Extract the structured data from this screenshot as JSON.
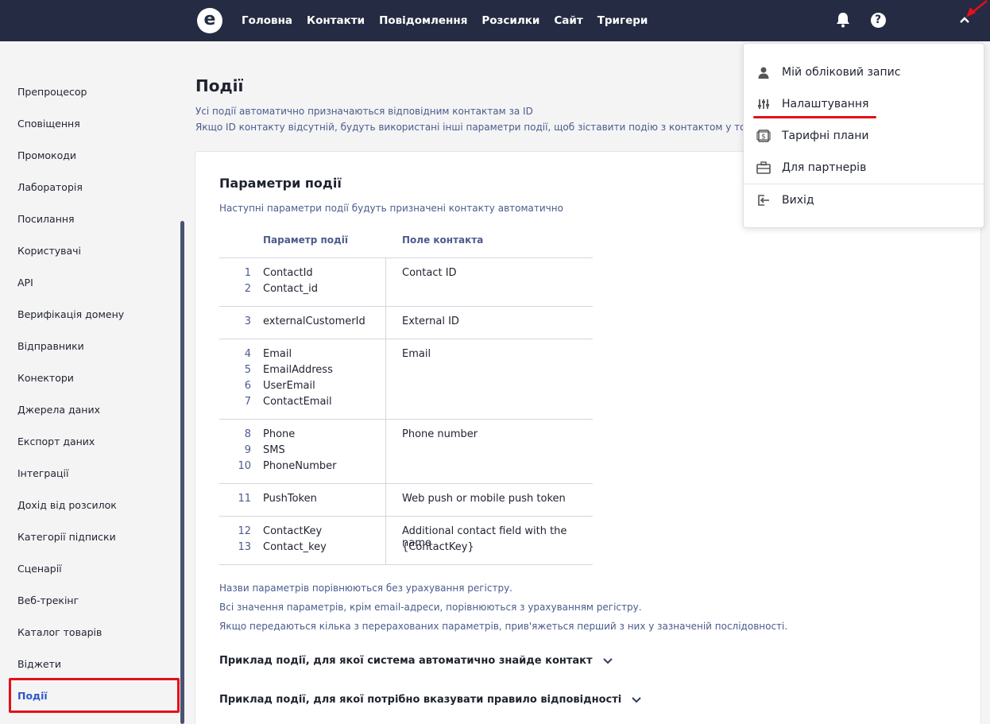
{
  "nav": {
    "items": [
      "Головна",
      "Контакти",
      "Повідомлення",
      "Розсилки",
      "Сайт",
      "Тригери"
    ]
  },
  "icons": {
    "logo": "e-logo",
    "bell": "bell-icon",
    "help": "help-icon",
    "chevron": "chevron-up-icon"
  },
  "sidebar": {
    "items": [
      "Препроцесор",
      "Сповіщення",
      "Промокоди",
      "Лабораторія",
      "Посилання",
      "Користувачі",
      "API",
      "Верифікація домену",
      "Відправники",
      "Конектори",
      "Джерела даних",
      "Експорт даних",
      "Інтеграції",
      "Дохід від розсилок",
      "Категорії підписки",
      "Сценарії",
      "Веб-трекінг",
      "Каталог товарів",
      "Віджети",
      "Події"
    ],
    "active": "Події"
  },
  "page": {
    "title": "Події",
    "desc1": "Усі події автоматично призначаються відповідним контактам за ID",
    "desc2": "Якщо ID контакту відсутній, будуть використані інші параметри події, щоб зіставити подію з контактом у тому по"
  },
  "card": {
    "title": "Параметри події",
    "subtitle": "Наступні параметри події будуть призначені контакту автоматично",
    "col_param": "Параметр події",
    "col_field": "Поле контакта",
    "groups": [
      {
        "rows": [
          [
            "1",
            "ContactId"
          ],
          [
            "2",
            "Contact_id"
          ]
        ],
        "field": [
          "Contact ID"
        ]
      },
      {
        "rows": [
          [
            "3",
            "externalCustomerId"
          ]
        ],
        "field": [
          "External ID"
        ]
      },
      {
        "rows": [
          [
            "4",
            "Email"
          ],
          [
            "5",
            "EmailAddress"
          ],
          [
            "6",
            "UserEmail"
          ],
          [
            "7",
            "ContactEmail"
          ]
        ],
        "field": [
          "Email"
        ]
      },
      {
        "rows": [
          [
            "8",
            "Phone"
          ],
          [
            "9",
            "SMS"
          ],
          [
            "10",
            "PhoneNumber"
          ]
        ],
        "field": [
          "Phone number"
        ]
      },
      {
        "rows": [
          [
            "11",
            "PushToken"
          ]
        ],
        "field": [
          "Web push or mobile push token"
        ]
      },
      {
        "rows": [
          [
            "12",
            "ContactKey"
          ],
          [
            "13",
            "Contact_key"
          ]
        ],
        "field": [
          "Additional contact field with the name",
          "{ContactKey}"
        ]
      }
    ],
    "notes": [
      "Назви параметрів порівнюються без урахування регістру.",
      "Всі значення параметрів, крім email-адреси, порівнюються з урахуванням регістру.",
      "Якщо передаються кілька з перерахованих параметрів, прив'яжеться перший з них у зазначеній послідовності."
    ],
    "accordion1": "Приклад події, для якої система автоматично знайде контакт",
    "accordion2": "Приклад події, для якої потрібно вказувати правило відповідності"
  },
  "menu": {
    "account": "Мій обліковий запис",
    "settings": "Налаштування",
    "plans": "Тарифні плани",
    "partners": "Для партнерів",
    "logout": "Вихід"
  },
  "colors": {
    "topbar": "#252b42",
    "accent": "#2f56c8",
    "highlight": "#e3101a"
  }
}
